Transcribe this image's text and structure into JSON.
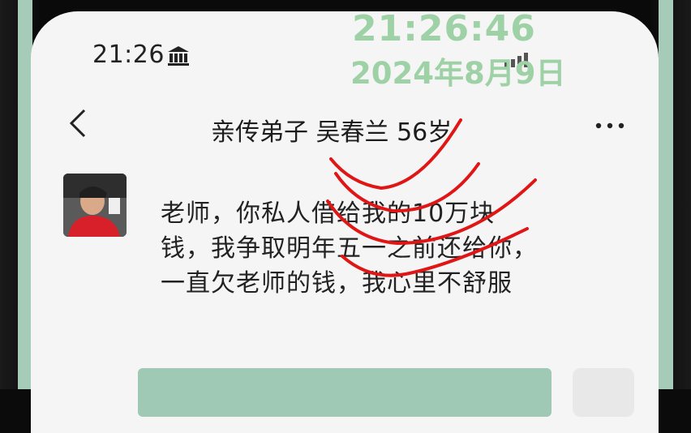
{
  "status_bar": {
    "time": "21:26",
    "bank_icon": "bank-icon",
    "signal_icon": "signal-icon"
  },
  "overlay": {
    "time": "21:26:46",
    "date": "2024年8月9日",
    "color": "#9ed2a6"
  },
  "nav": {
    "back_icon": "chevron-left-icon",
    "title": "亲传弟子 吴春兰 56岁",
    "more_icon": "more-dots-icon"
  },
  "chat": {
    "avatar": "avatar",
    "message": "老师，你私人借给我的10万块钱，我争取明年五一之前还给你，一直欠老师的钱，我心里不舒服"
  },
  "colors": {
    "screen_bg": "#f5f5f5",
    "text": "#222222",
    "annotation_red": "#e01515",
    "input_bar": "#9fc9b4"
  }
}
